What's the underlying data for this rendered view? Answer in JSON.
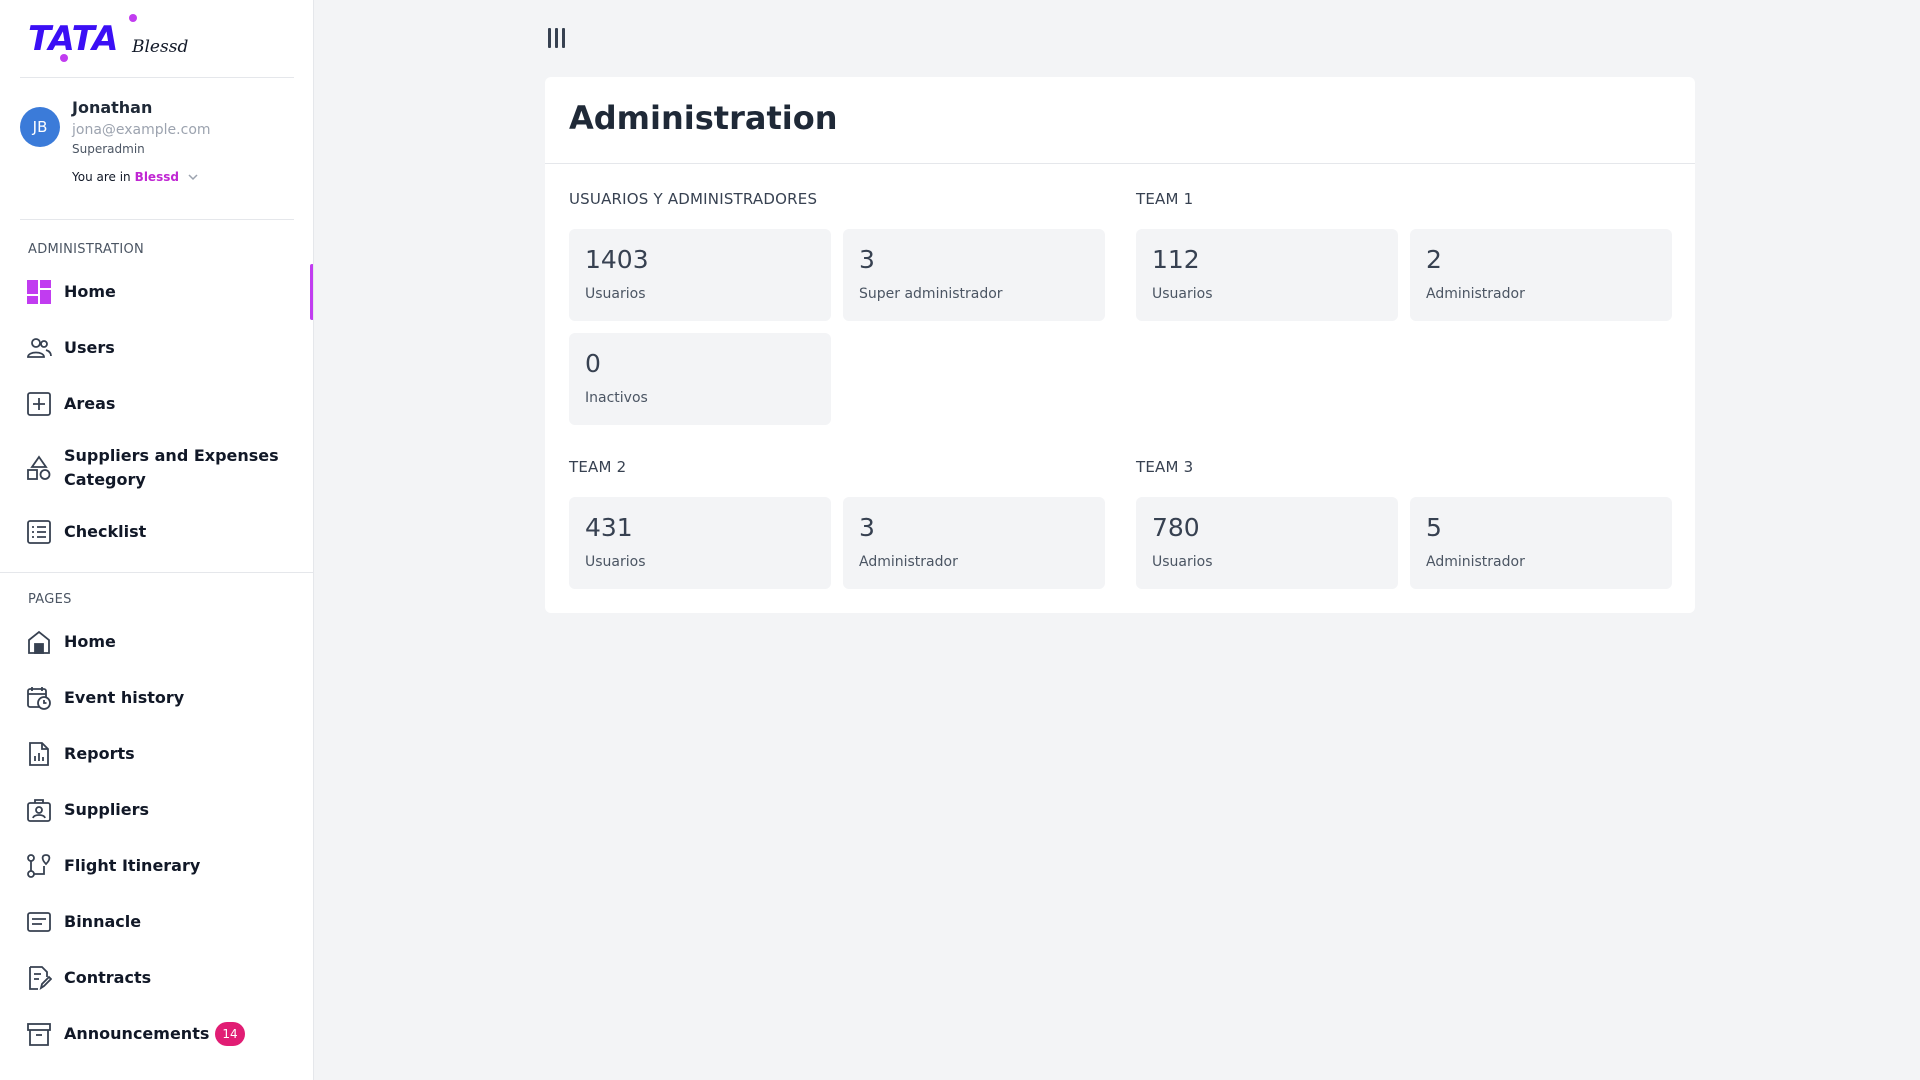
{
  "brand": {
    "logo_text": "TATA",
    "logo_script": "Blessd",
    "accent": "#c13cf0",
    "logo_color": "#3b0ff5"
  },
  "user": {
    "initials": "JB",
    "name": "Jonathan",
    "email": "jona@example.com",
    "role": "Superadmin",
    "org_prefix": "You are in",
    "org_name": "Blessd"
  },
  "sidebar": {
    "admin_section": "ADMINISTRATION",
    "admin_items": [
      {
        "label": "Home",
        "icon": "dashboard-icon",
        "active": true
      },
      {
        "label": "Users",
        "icon": "users-icon"
      },
      {
        "label": "Areas",
        "icon": "plus-square-icon"
      },
      {
        "label": "Suppliers and Expenses Category",
        "icon": "shapes-icon"
      },
      {
        "label": "Checklist",
        "icon": "checklist-icon"
      }
    ],
    "pages_section": "PAGES",
    "page_items": [
      {
        "label": "Home",
        "icon": "house-icon"
      },
      {
        "label": "Event history",
        "icon": "calendar-clock-icon"
      },
      {
        "label": "Reports",
        "icon": "report-icon"
      },
      {
        "label": "Suppliers",
        "icon": "badge-icon"
      },
      {
        "label": "Flight Itinerary",
        "icon": "route-icon"
      },
      {
        "label": "Binnacle",
        "icon": "notes-icon"
      },
      {
        "label": "Contracts",
        "icon": "contract-icon"
      },
      {
        "label": "Announcements",
        "icon": "archive-icon",
        "badge": "14"
      }
    ]
  },
  "main": {
    "title": "Administration",
    "groups": [
      {
        "title": "USUARIOS Y ADMINISTRADORES",
        "stats": [
          {
            "value": "1403",
            "label": "Usuarios"
          },
          {
            "value": "3",
            "label": "Super administrador"
          },
          {
            "value": "0",
            "label": "Inactivos"
          }
        ]
      },
      {
        "title": "TEAM 1",
        "stats": [
          {
            "value": "112",
            "label": "Usuarios"
          },
          {
            "value": "2",
            "label": "Administrador"
          }
        ]
      },
      {
        "title": "TEAM 2",
        "stats": [
          {
            "value": "431",
            "label": "Usuarios"
          },
          {
            "value": "3",
            "label": "Administrador"
          }
        ]
      },
      {
        "title": "TEAM 3",
        "stats": [
          {
            "value": "780",
            "label": "Usuarios"
          },
          {
            "value": "5",
            "label": "Administrador"
          }
        ]
      }
    ]
  }
}
